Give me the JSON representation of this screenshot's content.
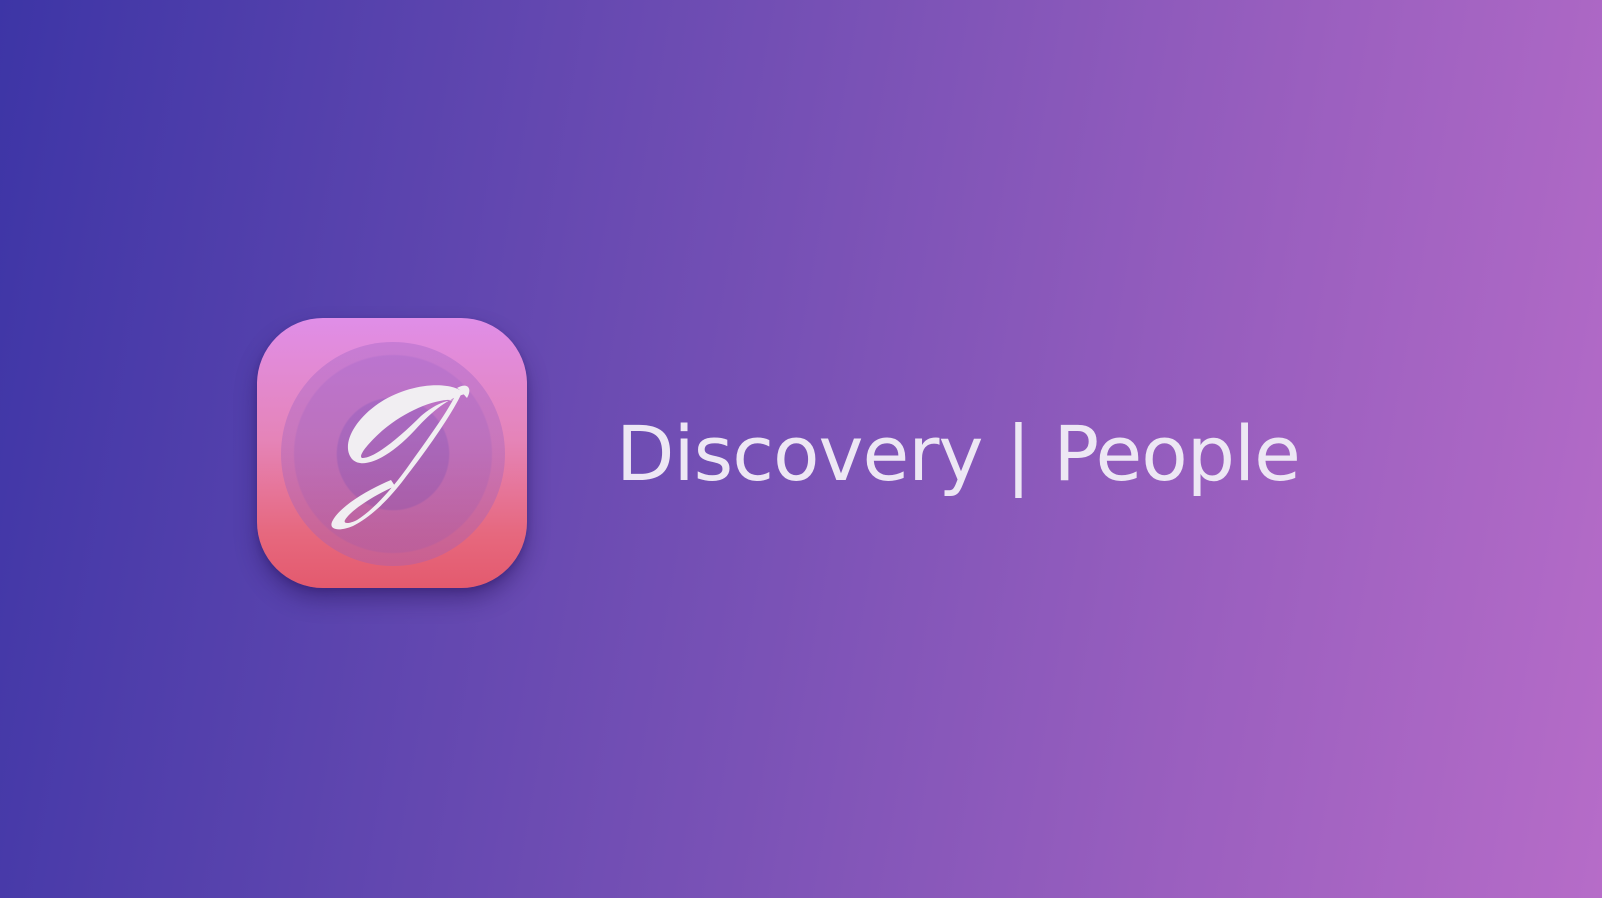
{
  "app": {
    "icon_name": "script-g-logo-icon",
    "title": "Discovery | People"
  },
  "colors": {
    "background_start": "#3d35a6",
    "background_end": "#b66cc8",
    "icon_top": "#e08ee8",
    "icon_bottom": "#e45a6e",
    "title_text": "#ede7f4"
  }
}
